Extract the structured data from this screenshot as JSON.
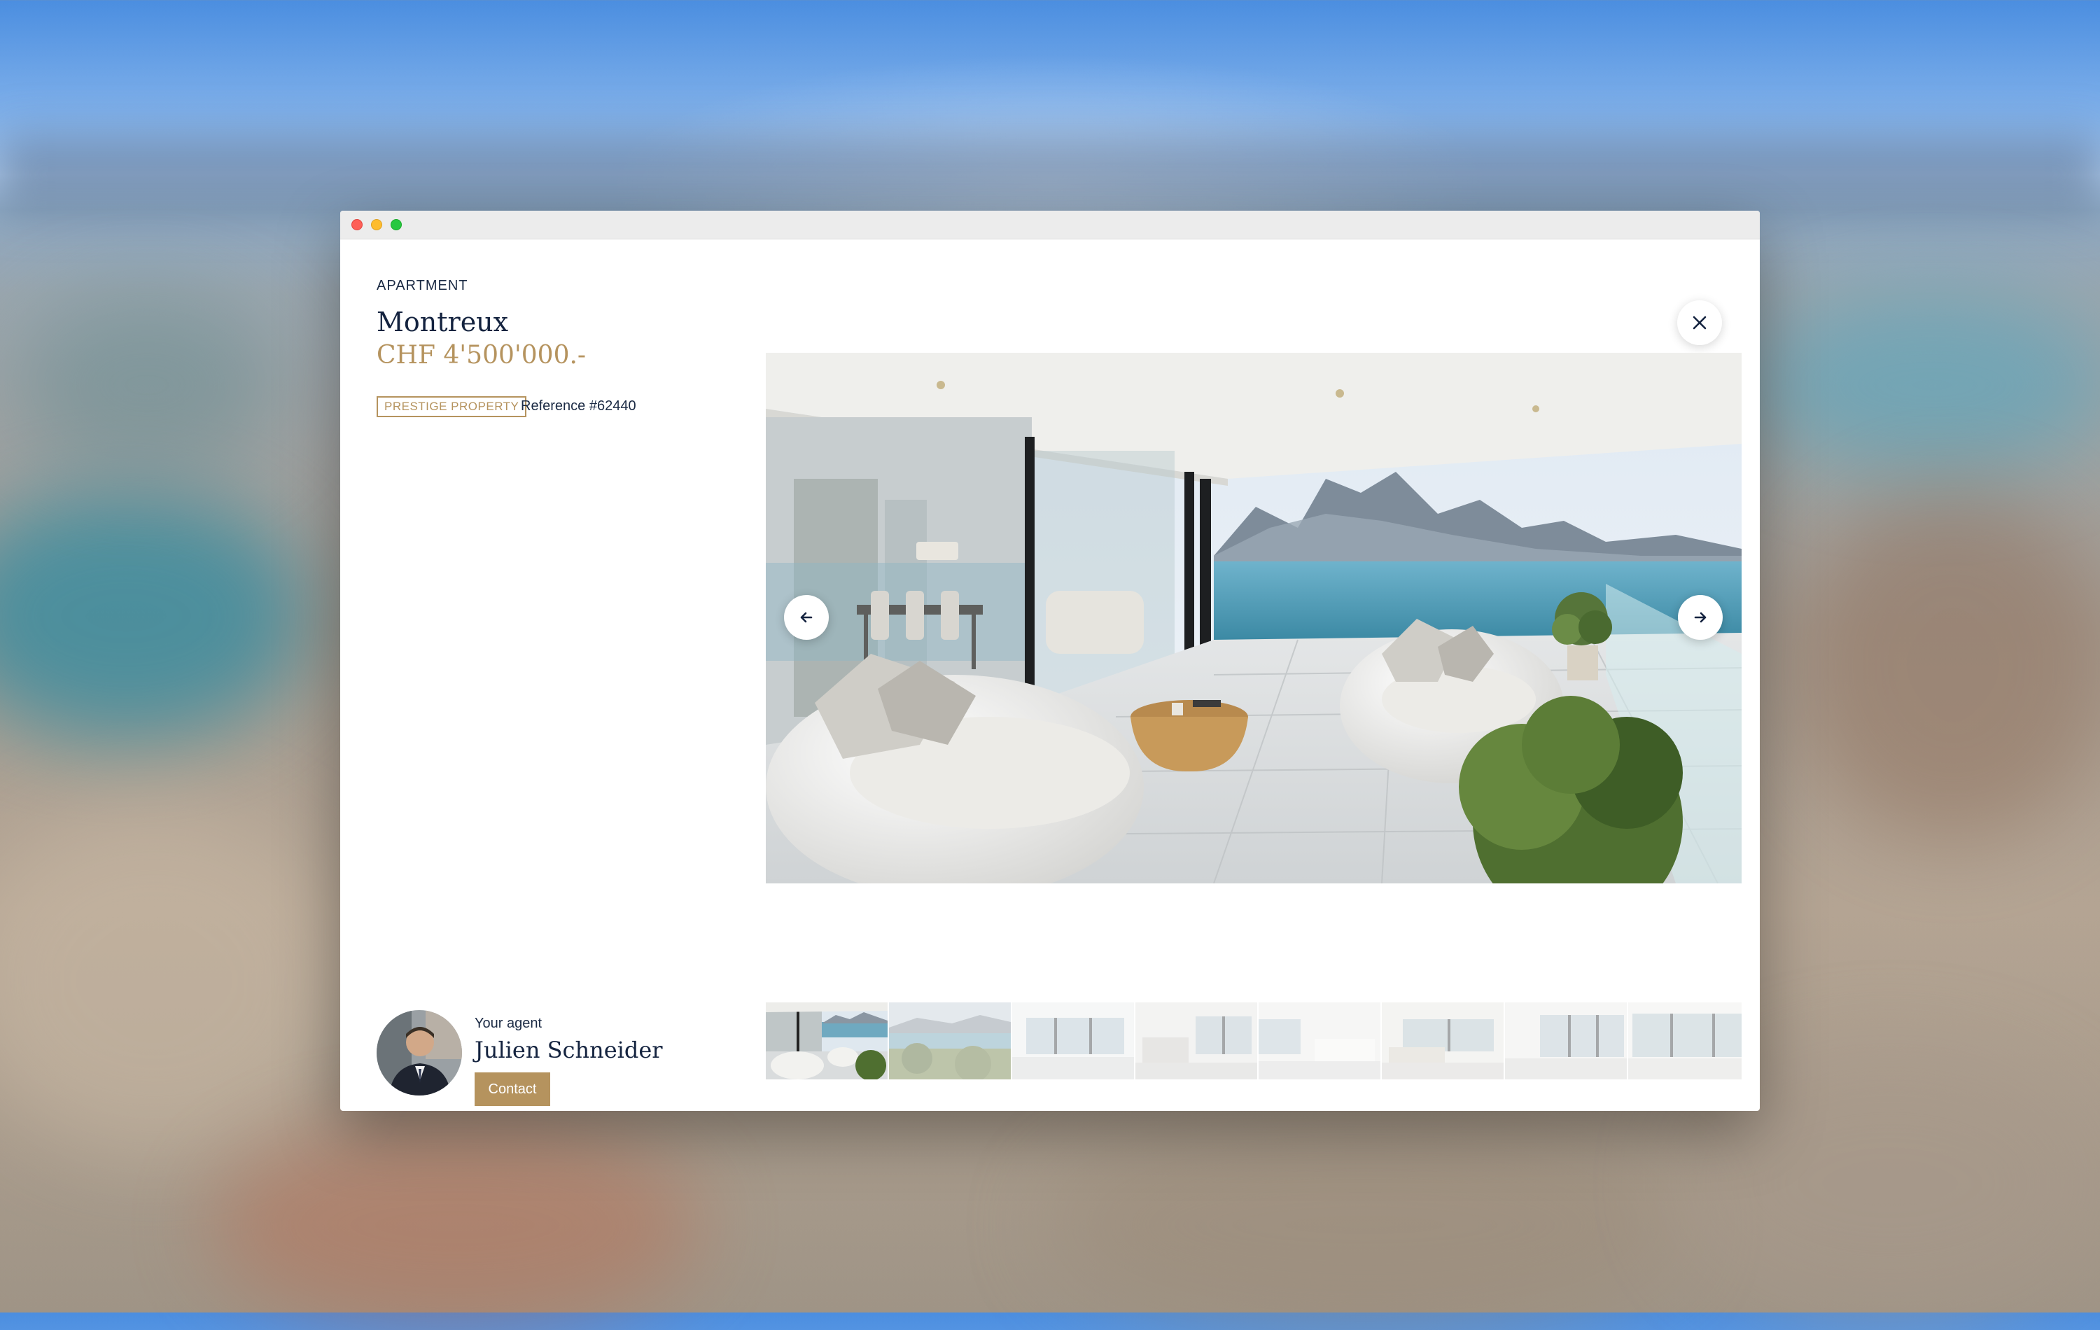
{
  "property": {
    "type": "APARTMENT",
    "city": "Montreux",
    "price": "CHF 4'500'000.-",
    "badge": "PRESTIGE PROPERTY",
    "reference": "Reference #62440"
  },
  "agent": {
    "label": "Your agent",
    "name": "Julien Schneider",
    "contact_label": "Contact"
  },
  "gallery": {
    "thumbnail_count": 8,
    "active_index": 0
  },
  "icons": {
    "close": "close-icon",
    "prev": "arrow-left-icon",
    "next": "arrow-right-icon"
  },
  "colors": {
    "accent": "#b5935e",
    "text": "#14233f"
  }
}
